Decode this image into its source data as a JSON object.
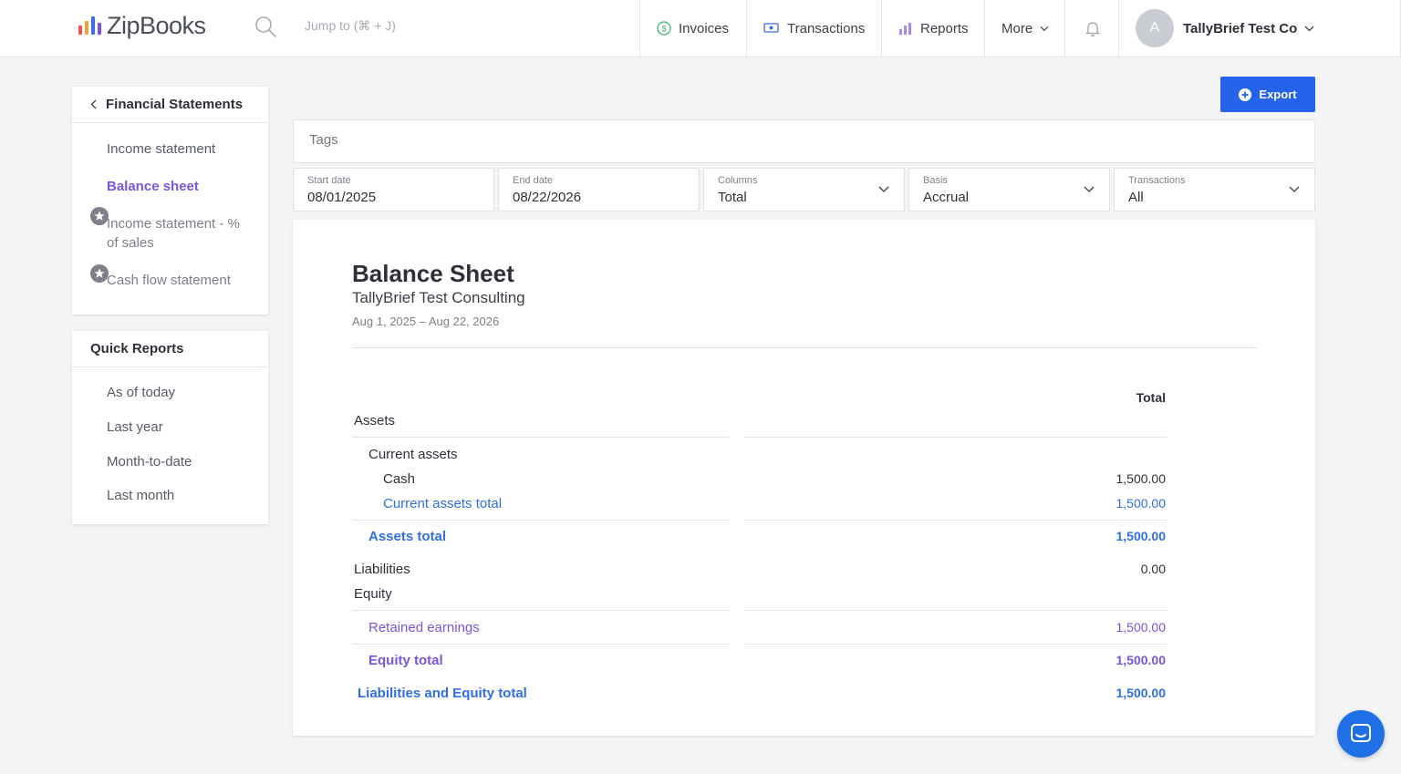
{
  "app": {
    "name": "ZipBooks"
  },
  "colors": {
    "accent": "#2563eb",
    "active_purple": "#7a55d8",
    "link_blue": "#2f6fe0",
    "background": "#f3f4f6"
  },
  "header": {
    "search_placeholder": "Jump to (⌘ + J)",
    "nav": [
      {
        "label": "Invoices",
        "icon": "dollar-circle-icon"
      },
      {
        "label": "Transactions",
        "icon": "money-icon"
      },
      {
        "label": "Reports",
        "icon": "bar-chart-icon"
      },
      {
        "label": "More",
        "icon": "chevron-down-icon"
      }
    ],
    "notifications_icon": "bell-icon",
    "avatar_initial": "A",
    "company": "TallyBrief Test Co"
  },
  "sidebar": {
    "financial": {
      "title": "Financial Statements",
      "items": [
        {
          "label": "Income statement",
          "active": false,
          "locked": false
        },
        {
          "label": "Balance sheet",
          "active": true,
          "locked": false
        },
        {
          "label": "Income statement - % of sales",
          "active": false,
          "locked": true
        },
        {
          "label": "Cash flow statement",
          "active": false,
          "locked": true
        }
      ]
    },
    "quick": {
      "title": "Quick Reports",
      "items": [
        "As of today",
        "Last year",
        "Month-to-date",
        "Last month"
      ]
    }
  },
  "toolbar": {
    "export_label": "Export"
  },
  "filters": {
    "tags_placeholder": "Tags",
    "start_date": {
      "label": "Start date",
      "value": "08/01/2025"
    },
    "end_date": {
      "label": "End date",
      "value": "08/22/2026"
    },
    "columns": {
      "label": "Columns",
      "value": "Total"
    },
    "basis": {
      "label": "Basis",
      "value": "Accrual"
    },
    "transactions": {
      "label": "Transactions",
      "value": "All"
    }
  },
  "report": {
    "title": "Balance Sheet",
    "company": "TallyBrief Test Consulting",
    "date_range": "Aug 1, 2025 – Aug 22, 2026",
    "column_header": "Total",
    "rows": {
      "assets": {
        "label": "Assets"
      },
      "current_assets": {
        "label": "Current assets"
      },
      "cash": {
        "label": "Cash",
        "value": "1,500.00"
      },
      "current_assets_total": {
        "label": "Current assets total",
        "value": "1,500.00"
      },
      "assets_total": {
        "label": "Assets total",
        "value": "1,500.00"
      },
      "liabilities": {
        "label": "Liabilities",
        "value": "0.00"
      },
      "equity": {
        "label": "Equity"
      },
      "retained_earnings": {
        "label": "Retained earnings",
        "value": "1,500.00"
      },
      "equity_total": {
        "label": "Equity total",
        "value": "1,500.00"
      },
      "liab_equity_total": {
        "label": "Liabilities and Equity total",
        "value": "1,500.00"
      }
    }
  },
  "chat": {
    "icon": "chat-icon"
  }
}
